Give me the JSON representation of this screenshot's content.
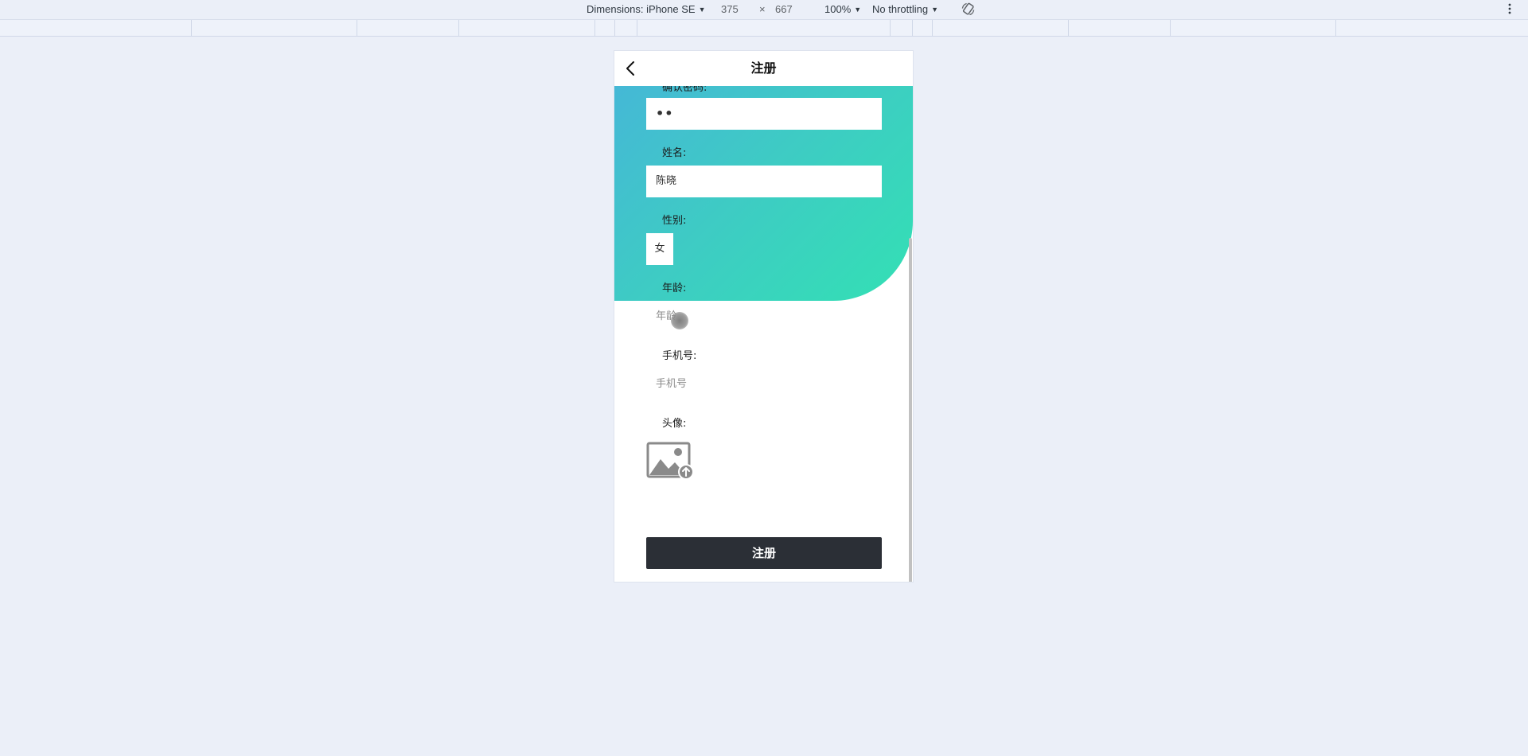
{
  "devtools": {
    "dimensions_label": "Dimensions: iPhone SE",
    "width_value": "375",
    "times": "×",
    "height_value": "667",
    "zoom": "100%",
    "throttling": "No throttling"
  },
  "page": {
    "title": "注册",
    "fields": {
      "confirm_password": {
        "label": "确认密码:",
        "value": "••"
      },
      "name": {
        "label": "姓名:",
        "value": "陈晓"
      },
      "gender": {
        "label": "性别:",
        "value": "女"
      },
      "age": {
        "label": "年龄:",
        "placeholder": "年龄"
      },
      "phone": {
        "label": "手机号:",
        "placeholder": "手机号"
      },
      "avatar": {
        "label": "头像:"
      }
    },
    "submit_label": "注册"
  },
  "colors": {
    "gradient_start": "#45b8d6",
    "gradient_end": "#33e0b4",
    "button": "#2b2f36",
    "page_bg": "#ebeff8"
  },
  "icons": {
    "back": "chevron-left-icon",
    "avatar_upload": "image-upload-icon",
    "rotate": "rotate-icon",
    "more": "kebab-menu-icon"
  }
}
